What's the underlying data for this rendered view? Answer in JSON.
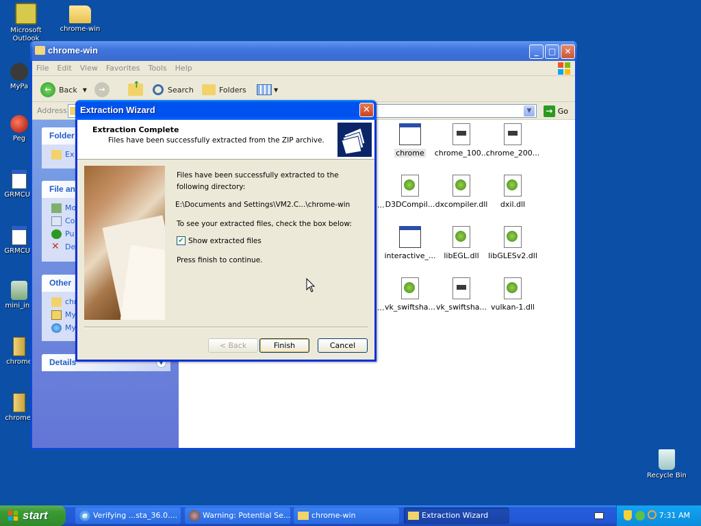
{
  "desktop": {
    "icons": [
      {
        "label": "Microsoft Outlook",
        "icon": "outlook-icon"
      },
      {
        "label": "chrome-win",
        "icon": "folder-icon"
      },
      {
        "label": "MyPa",
        "icon": "my-pc-icon"
      },
      {
        "label": "Peg",
        "icon": "app-icon"
      },
      {
        "label": "GRMCUL",
        "icon": "window-icon"
      },
      {
        "label": "GRMCUL",
        "icon": "window-icon"
      },
      {
        "label": "mini_ins",
        "icon": "installer-icon"
      },
      {
        "label": "chrome",
        "icon": "zip-icon"
      },
      {
        "label": "chrome-",
        "icon": "zip-icon"
      },
      {
        "label": "Recycle Bin",
        "icon": "recycle-bin-icon"
      }
    ]
  },
  "explorer": {
    "title": "chrome-win",
    "menu": [
      "File",
      "Edit",
      "View",
      "Favorites",
      "Tools",
      "Help"
    ],
    "toolbar": {
      "back": "Back",
      "search": "Search",
      "folders": "Folders"
    },
    "address_label": "Address",
    "go_label": "Go",
    "panels": {
      "folder": {
        "title": "Folder",
        "rows": [
          "Ex"
        ]
      },
      "file": {
        "title": "File an",
        "rows": [
          "Mo",
          "Co",
          "Pu",
          "De"
        ]
      },
      "other": {
        "title": "Other",
        "rows": [
          "chr",
          "My",
          "My"
        ]
      },
      "details": {
        "title": "Details"
      }
    },
    "files": [
      {
        "name": "chrome",
        "icon": "exe-window-icon"
      },
      {
        "name": "chrome_100...",
        "icon": "file-icon"
      },
      {
        "name": "chrome_200...",
        "icon": "file-icon"
      },
      {
        "name": "D3DCompil...",
        "icon": "dll-icon"
      },
      {
        "name": "dxcompiler.dll",
        "icon": "dll-icon"
      },
      {
        "name": "dxil.dll",
        "icon": "dll-icon"
      },
      {
        "name": "interactive_...",
        "icon": "exe-window-icon"
      },
      {
        "name": "libEGL.dll",
        "icon": "dll-icon"
      },
      {
        "name": "libGLESv2.dll",
        "icon": "dll-icon"
      },
      {
        "name": "vk_swiftsha...",
        "icon": "dll-icon"
      },
      {
        "name": "vk_swiftsha...",
        "icon": "file-icon"
      },
      {
        "name": "vulkan-1.dll",
        "icon": "dll-icon"
      }
    ],
    "partial_left_label": "..."
  },
  "wizard": {
    "title": "Extraction Wizard",
    "header_title": "Extraction Complete",
    "header_subtitle": "Files have been successfully extracted from the ZIP archive.",
    "line1": "Files have been successfully extracted to the following directory:",
    "path": "E:\\Documents and Settings\\VM2.C...\\chrome-win",
    "line2": "To see your extracted files, check the box below:",
    "checkbox_label": "Show extracted files",
    "checkbox_checked": true,
    "line3": "Press finish to continue.",
    "buttons": {
      "back": "< Back",
      "finish": "Finish",
      "cancel": "Cancel"
    }
  },
  "taskbar": {
    "start": "start",
    "tasks": [
      {
        "label": "Verifying ...sta_36.0....",
        "icon": "ie-icon",
        "active": false
      },
      {
        "label": "Warning: Potential Se...",
        "icon": "warning-app-icon",
        "active": false
      },
      {
        "label": "chrome-win",
        "icon": "folder-icon",
        "active": false
      },
      {
        "label": "Extraction Wizard",
        "icon": "folder-icon",
        "active": true
      }
    ],
    "clock": "7:31 AM"
  }
}
